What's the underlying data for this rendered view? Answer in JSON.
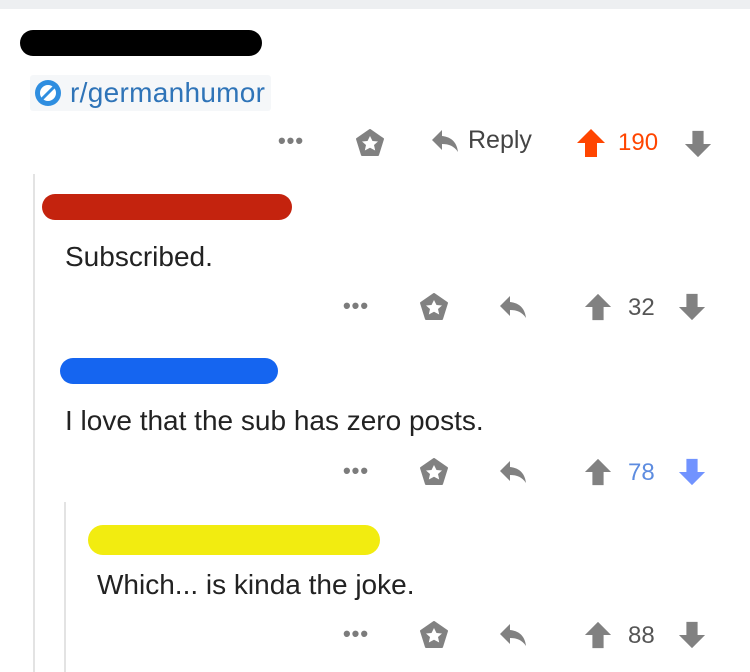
{
  "subreddit": {
    "name": "r/germanhumor"
  },
  "post_actions": {
    "more": "•••",
    "reply_label": "Reply",
    "score": "190"
  },
  "comments": [
    {
      "text": "Subscribed.",
      "score": "32",
      "more": "•••"
    },
    {
      "text": "I love that the sub has zero posts.",
      "score": "78",
      "more": "•••"
    },
    {
      "text": "Which... is kinda the joke.",
      "score": "88",
      "more": "•••"
    }
  ],
  "colors": {
    "upvote_active": "#ff4500",
    "downvote_active": "#7193ff",
    "score_blue": "#5d8ce0",
    "icon_gray": "#818181",
    "sub_link": "#2f74b8"
  },
  "icons": [
    "subreddit-icon",
    "award-icon",
    "reply-arrow-icon",
    "upvote-arrow-icon",
    "downvote-arrow-icon",
    "more-dots-icon"
  ]
}
